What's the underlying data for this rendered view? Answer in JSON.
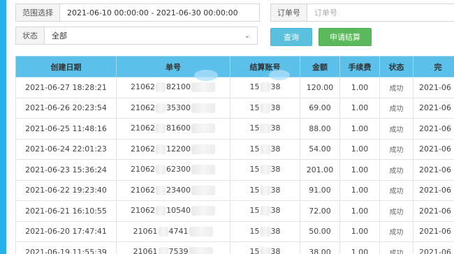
{
  "filters": {
    "range_label": "范围选择",
    "range_value": "2021-06-10 00:00:00 - 2021-06-30 00:00:00",
    "order_label": "订单号",
    "order_placeholder": "订单号",
    "status_label": "状态",
    "status_value": "全部"
  },
  "buttons": {
    "query": "查询",
    "settle": "申请结算"
  },
  "table": {
    "headers": [
      "创建日期",
      "单号",
      "结算账号",
      "金额",
      "手续费",
      "状态",
      "完"
    ],
    "rows": [
      {
        "created": "2021-06-27 18:28:21",
        "order_a": "21062",
        "order_b": "82100",
        "account_a": "15",
        "account_b": "38",
        "amount": "120.00",
        "fee": "1.00",
        "status": "成功",
        "done": "2021-06"
      },
      {
        "created": "2021-06-26 20:23:54",
        "order_a": "21062",
        "order_b": "35300",
        "account_a": "15",
        "account_b": "38",
        "amount": "69.00",
        "fee": "1.00",
        "status": "成功",
        "done": "2021-06"
      },
      {
        "created": "2021-06-25 11:48:16",
        "order_a": "21062",
        "order_b": "81600",
        "account_a": "15",
        "account_b": "38",
        "amount": "88.00",
        "fee": "1.00",
        "status": "成功",
        "done": "2021-06"
      },
      {
        "created": "2021-06-24 22:01:23",
        "order_a": "21062",
        "order_b": "12200",
        "account_a": "15",
        "account_b": "38",
        "amount": "54.00",
        "fee": "1.00",
        "status": "成功",
        "done": "2021-06"
      },
      {
        "created": "2021-06-23 15:36:24",
        "order_a": "21062",
        "order_b": "62300",
        "account_a": "15",
        "account_b": "38",
        "amount": "201.00",
        "fee": "1.00",
        "status": "成功",
        "done": "2021-06"
      },
      {
        "created": "2021-06-22 19:23:40",
        "order_a": "21062",
        "order_b": "23400",
        "account_a": "15",
        "account_b": "38",
        "amount": "91.00",
        "fee": "1.00",
        "status": "成功",
        "done": "2021-06"
      },
      {
        "created": "2021-06-21 16:10:55",
        "order_a": "21062",
        "order_b": "10540",
        "account_a": "15",
        "account_b": "38",
        "amount": "72.00",
        "fee": "1.00",
        "status": "成功",
        "done": "2021-06"
      },
      {
        "created": "2021-06-20 17:47:41",
        "order_a": "21061",
        "order_b": "4741",
        "account_a": "15",
        "account_b": "38",
        "amount": "50.00",
        "fee": "1.00",
        "status": "成功",
        "done": "2021-06"
      },
      {
        "created": "2021-06-19 11:55:39",
        "order_a": "21061",
        "order_b": "7539",
        "account_a": "15",
        "account_b": "38",
        "amount": "38.00",
        "fee": "1.00",
        "status": "成功",
        "done": "2021-06"
      }
    ]
  }
}
